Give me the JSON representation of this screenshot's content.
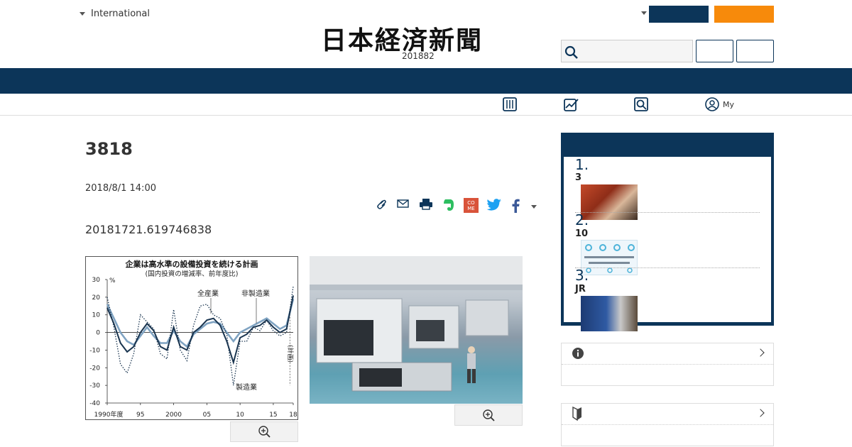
{
  "header": {
    "edition_label": "International",
    "logo_text": "日本経済新聞",
    "logo_date": "201882"
  },
  "colors": {
    "brand_navy": "#0c3559",
    "accent_orange": "#f78a0b"
  },
  "subnav": {
    "my_label": "My"
  },
  "article": {
    "title": "3818",
    "date": "2018/8/1 14:00",
    "lead": "20181721.619746838"
  },
  "chart_data": {
    "type": "line",
    "title": "企業は高水準の設備投資を続ける計画",
    "subtitle": "(国内投資の増減率、前年度比)",
    "ylabel": "%",
    "ylim": [
      -40,
      30
    ],
    "yticks": [
      "30",
      "20",
      "10",
      "0",
      "-10",
      "-20",
      "-30",
      "-40"
    ],
    "xticks": [
      "1990年度",
      "95",
      "2000",
      "05",
      "10",
      "15",
      "18"
    ],
    "x": [
      1990,
      1991,
      1992,
      1993,
      1994,
      1995,
      1996,
      1997,
      1998,
      1999,
      2000,
      2001,
      2002,
      2003,
      2004,
      2005,
      2006,
      2007,
      2008,
      2009,
      2010,
      2011,
      2012,
      2013,
      2014,
      2015,
      2016,
      2017,
      2018
    ],
    "series": [
      {
        "name": "全産業",
        "style": "solid-dark",
        "values": [
          14,
          5,
          -6,
          -11,
          -8,
          0,
          5,
          1,
          -8,
          -10,
          3,
          -8,
          -10,
          0,
          3,
          7,
          8,
          4,
          -5,
          -17,
          -3,
          -1,
          3,
          4,
          7,
          3,
          0,
          2,
          21
        ]
      },
      {
        "name": "非製造業",
        "style": "solid-light",
        "values": [
          16,
          8,
          0,
          -5,
          -7,
          -2,
          3,
          -2,
          -6,
          -6,
          1,
          -5,
          -8,
          -1,
          2,
          5,
          6,
          5,
          0,
          -5,
          0,
          2,
          4,
          6,
          8,
          5,
          2,
          4,
          19
        ]
      },
      {
        "name": "製造業",
        "style": "dotted",
        "values": [
          20,
          3,
          -18,
          -23,
          -12,
          10,
          6,
          2,
          -12,
          -15,
          13,
          -10,
          -16,
          4,
          15,
          16,
          10,
          8,
          -1,
          -30,
          -5,
          -5,
          3,
          1,
          7,
          1,
          -2,
          0,
          26
        ]
      }
    ],
    "annotations": [
      "(計画)"
    ]
  }
}
